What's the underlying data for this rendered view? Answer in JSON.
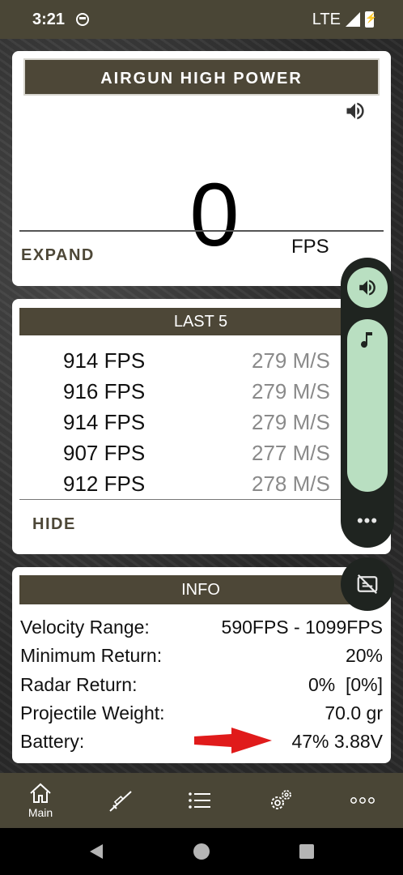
{
  "status_bar": {
    "time": "3:21",
    "network": "LTE"
  },
  "main_card": {
    "title": "AIRGUN HIGH POWER",
    "value": "0",
    "unit": "FPS",
    "expand_label": "EXPAND",
    "icons": [
      "speaker-icon"
    ]
  },
  "last5": {
    "title": "LAST 5",
    "rows": [
      {
        "fps": "914 FPS",
        "ms": "279 M/S"
      },
      {
        "fps": "916 FPS",
        "ms": "279 M/S"
      },
      {
        "fps": "914 FPS",
        "ms": "279 M/S"
      },
      {
        "fps": "907 FPS",
        "ms": "277 M/S"
      },
      {
        "fps": "912 FPS",
        "ms": "278 M/S"
      }
    ],
    "hide_label": "HIDE"
  },
  "info": {
    "title": "INFO",
    "rows": [
      {
        "key": "Velocity Range:",
        "value": "590FPS - 1099FPS"
      },
      {
        "key": "Minimum Return:",
        "value": "20%"
      },
      {
        "key": "Radar Return:",
        "value": "0%  [0%]"
      },
      {
        "key": "Projectile Weight:",
        "value": "70.0 gr"
      },
      {
        "key": "Battery:",
        "value": "47% 3.88V"
      }
    ]
  },
  "volume_panel": {
    "icons": [
      "speaker-icon",
      "music-note-icon",
      "more-dots-icon",
      "caption-off-icon"
    ],
    "more_label": "•••"
  },
  "bottom_nav": {
    "items": [
      {
        "label": "Main",
        "icon": "home-icon"
      },
      {
        "label": "",
        "icon": "rifle-icon"
      },
      {
        "label": "",
        "icon": "list-icon"
      },
      {
        "label": "",
        "icon": "gear-icon"
      },
      {
        "label": "",
        "icon": "more-icon"
      }
    ]
  },
  "colors": {
    "header": "#4d4737",
    "statusbar": "#4a4636",
    "accent_green": "#b9dfc1",
    "arrow": "#e01b1b"
  }
}
